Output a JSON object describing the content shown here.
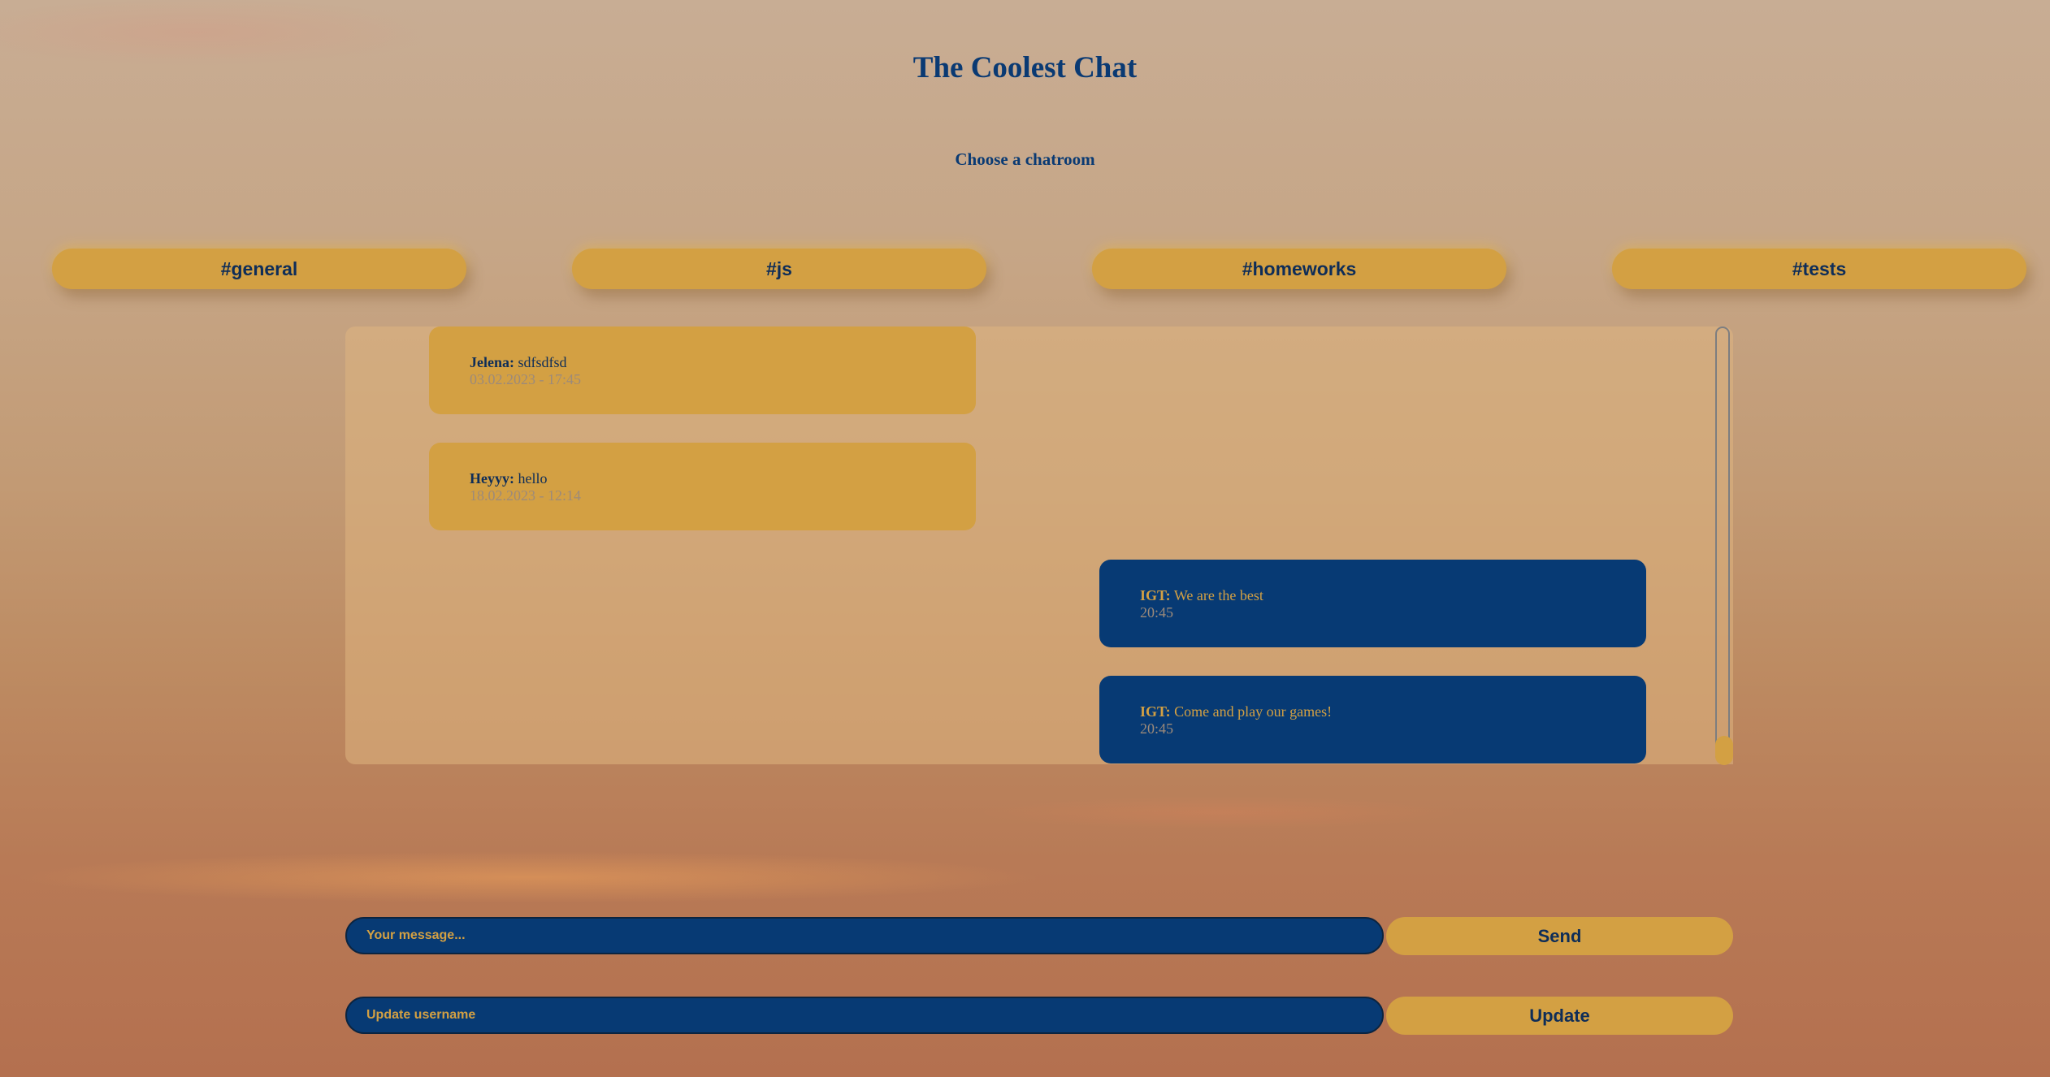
{
  "header": {
    "title": "The Coolest Chat",
    "subtitle": "Choose a chatroom"
  },
  "rooms": [
    {
      "label": "#general"
    },
    {
      "label": "#js"
    },
    {
      "label": "#homeworks"
    },
    {
      "label": "#tests"
    }
  ],
  "messages": [
    {
      "author": "Jelena:",
      "text": "sdfsdfsd",
      "time": "03.02.2023 - 17:45",
      "own": false
    },
    {
      "author": "Heyyy:",
      "text": "hello",
      "time": "18.02.2023 - 12:14",
      "own": false
    },
    {
      "author": "IGT:",
      "text": "We are the best",
      "time": "20:45",
      "own": true
    },
    {
      "author": "IGT:",
      "text": "Come and play our games!",
      "time": "20:45",
      "own": true
    }
  ],
  "composer": {
    "message_placeholder": "Your message...",
    "send_label": "Send",
    "username_placeholder": "Update username",
    "update_label": "Update"
  },
  "colors": {
    "accent": "#d3a043",
    "primary": "#073a74",
    "text_dark": "#0e2d58"
  }
}
